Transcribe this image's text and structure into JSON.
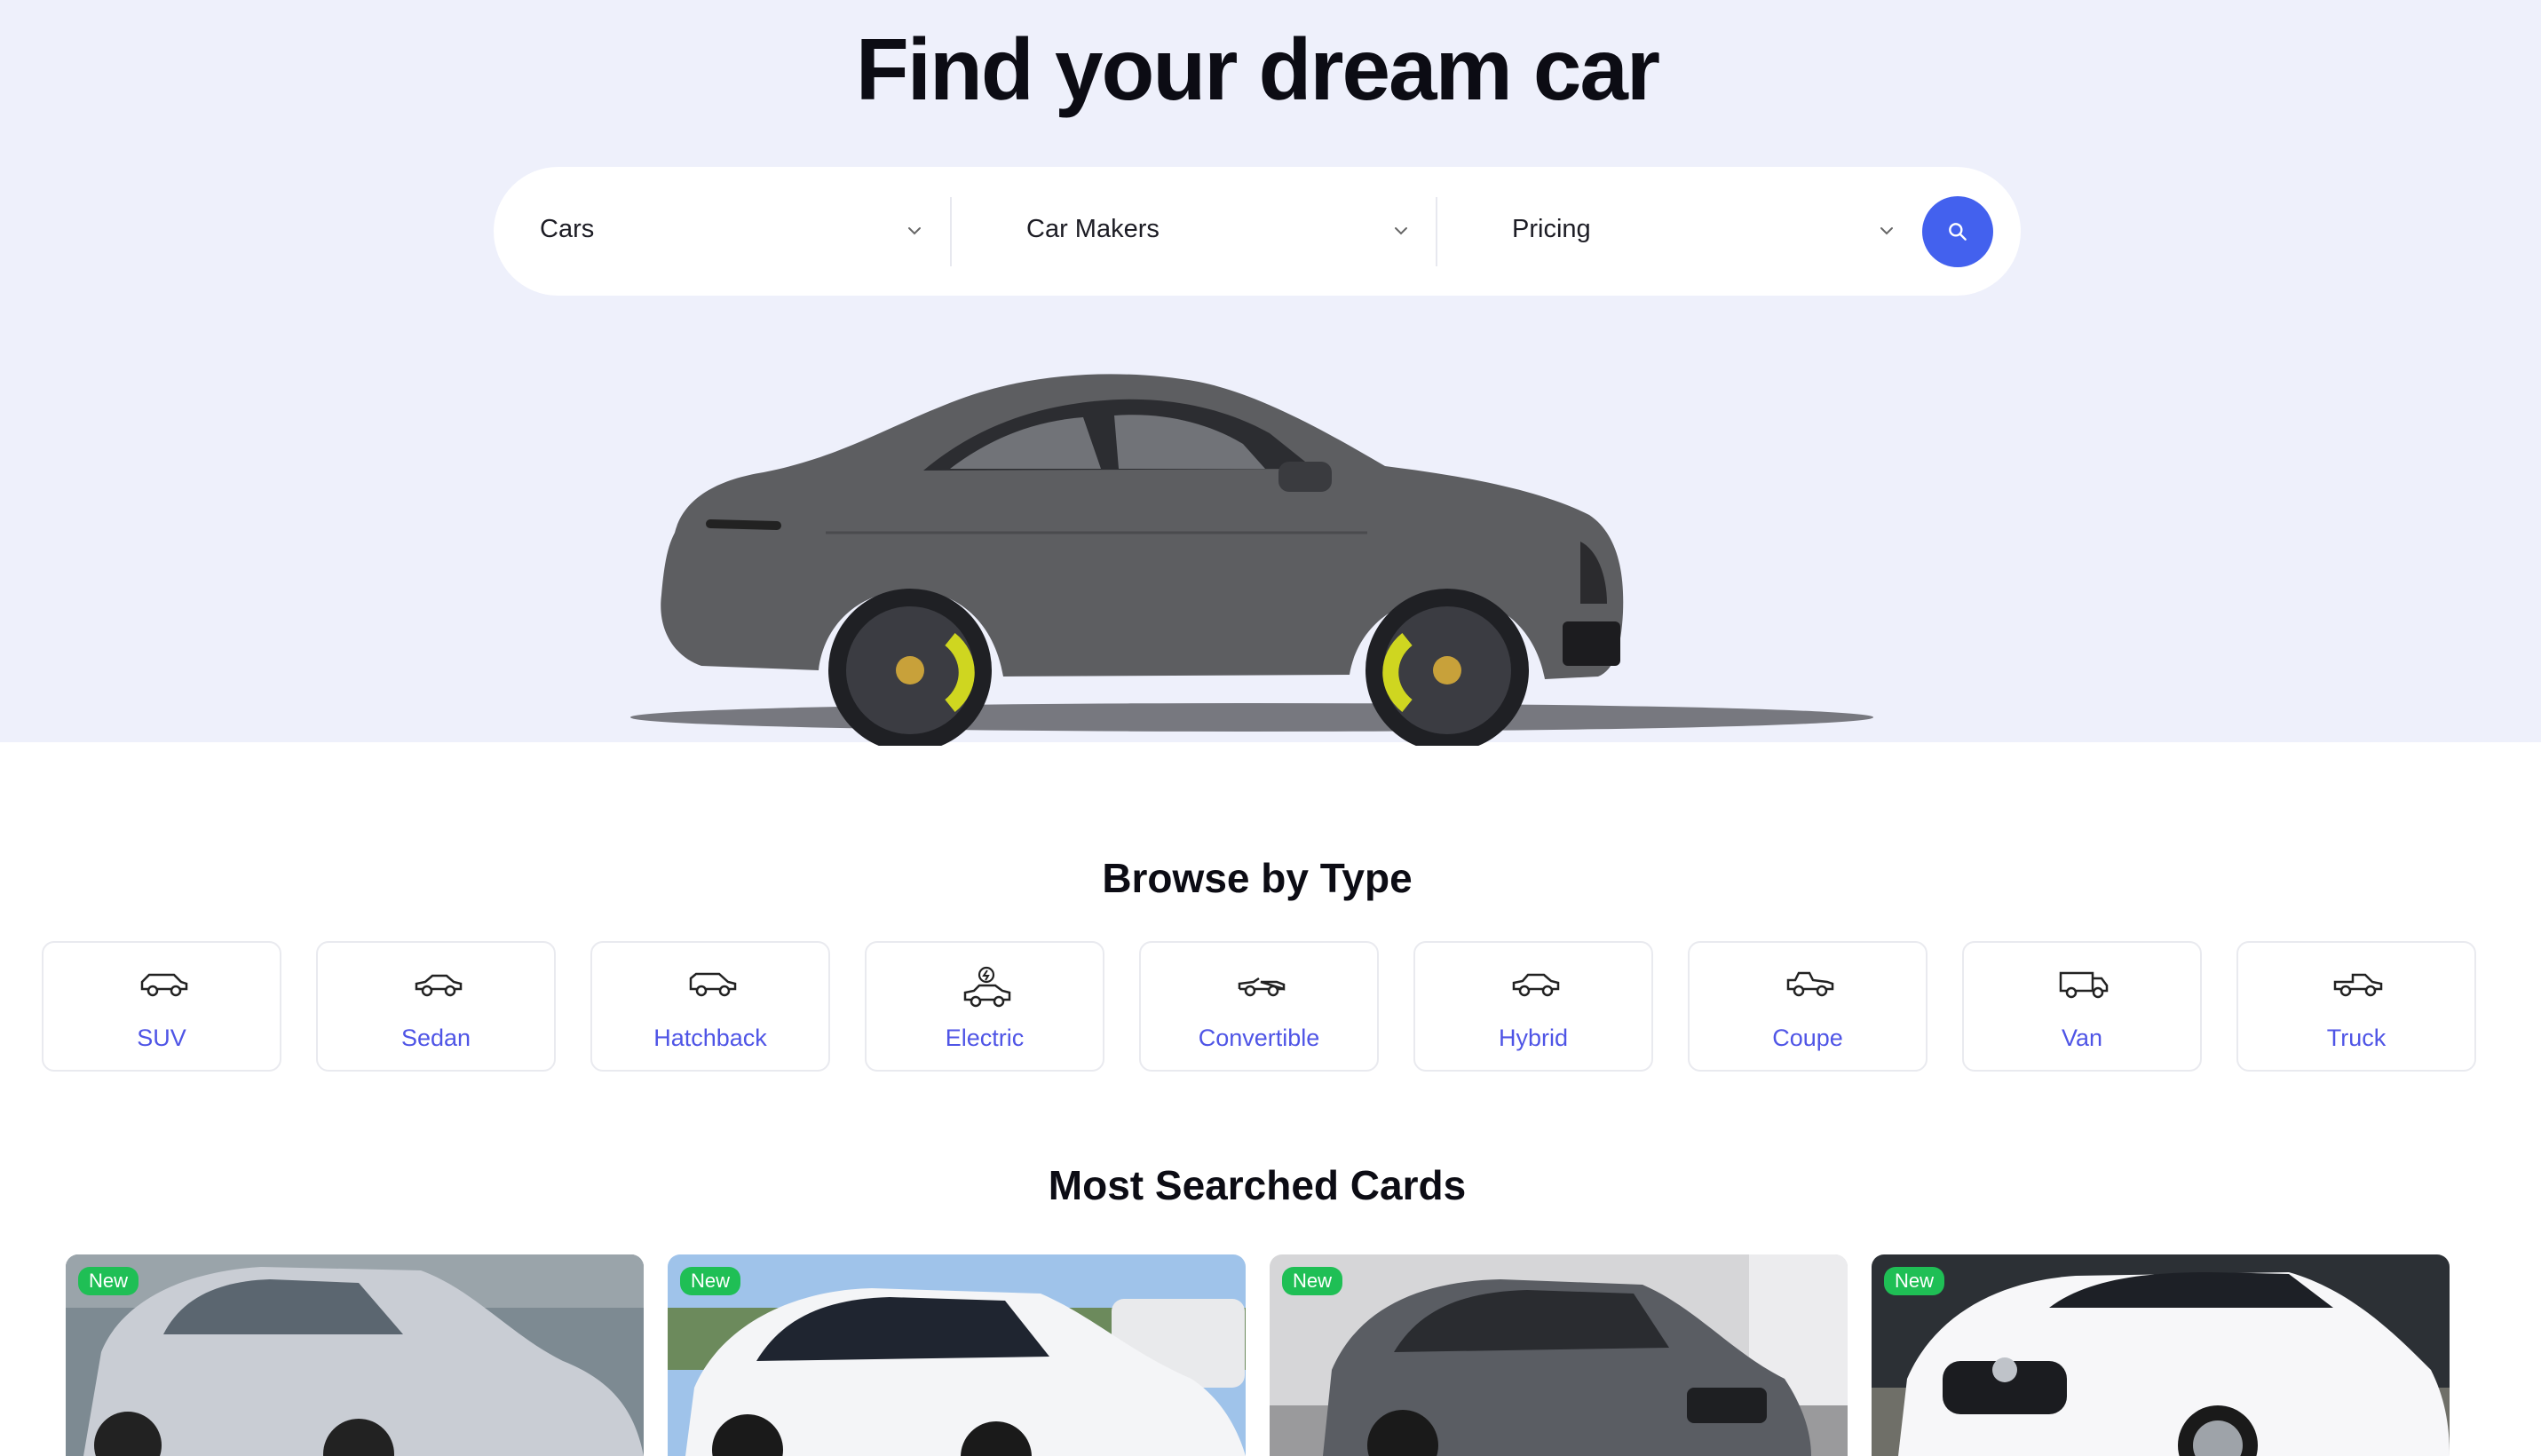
{
  "hero": {
    "title": "Find your dream car"
  },
  "search": {
    "fields": [
      {
        "label": "Cars",
        "icon": "chevron-down-icon"
      },
      {
        "label": "Car Makers",
        "icon": "chevron-down-icon"
      },
      {
        "label": "Pricing",
        "icon": "chevron-down-icon"
      }
    ],
    "button_icon": "search-icon"
  },
  "browse": {
    "title": "Browse by Type",
    "types": [
      {
        "label": "SUV",
        "icon": "suv-icon"
      },
      {
        "label": "Sedan",
        "icon": "sedan-icon"
      },
      {
        "label": "Hatchback",
        "icon": "hatchback-icon"
      },
      {
        "label": "Electric",
        "icon": "electric-car-icon"
      },
      {
        "label": "Convertible",
        "icon": "convertible-icon"
      },
      {
        "label": "Hybrid",
        "icon": "hybrid-icon"
      },
      {
        "label": "Coupe",
        "icon": "coupe-icon"
      },
      {
        "label": "Van",
        "icon": "van-icon"
      },
      {
        "label": "Truck",
        "icon": "truck-icon"
      }
    ]
  },
  "most_searched": {
    "title": "Most Searched Cards",
    "cards": [
      {
        "badge": "New",
        "car_color": "#c9cdd4",
        "bg": "#7d8a92"
      },
      {
        "badge": "New",
        "car_color": "#f4f5f7",
        "bg": "#9fc3ea"
      },
      {
        "badge": "New",
        "car_color": "#5a5d63",
        "bg": "#d6d6d8"
      },
      {
        "badge": "New",
        "car_color": "#f7f7f9",
        "bg": "#2c3035"
      }
    ]
  },
  "colors": {
    "accent": "#4361ee",
    "type_label": "#4f55e6",
    "badge": "#1fbf55",
    "hero_bg": "#eef0fb"
  }
}
